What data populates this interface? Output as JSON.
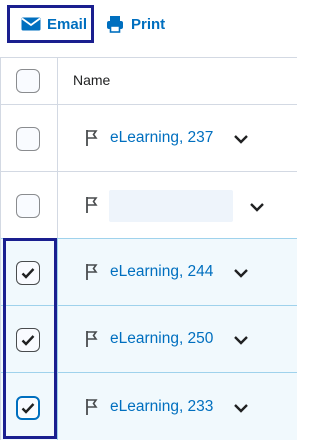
{
  "toolbar": {
    "email_label": "Email",
    "print_label": "Print",
    "email_icon": "envelope-icon",
    "print_icon": "printer-icon"
  },
  "table": {
    "header": {
      "name_label": "Name"
    },
    "rows": [
      {
        "name": "eLearning, 237",
        "checked": false
      },
      {
        "name": "",
        "checked": false,
        "redacted": true
      },
      {
        "name": "eLearning, 244",
        "checked": true
      },
      {
        "name": "eLearning, 250",
        "checked": true
      },
      {
        "name": "eLearning, 233",
        "checked": true
      }
    ]
  },
  "colors": {
    "link": "#006fbf",
    "highlight": "#1a1f8f",
    "selected_row_bg": "#f1f9fd"
  }
}
